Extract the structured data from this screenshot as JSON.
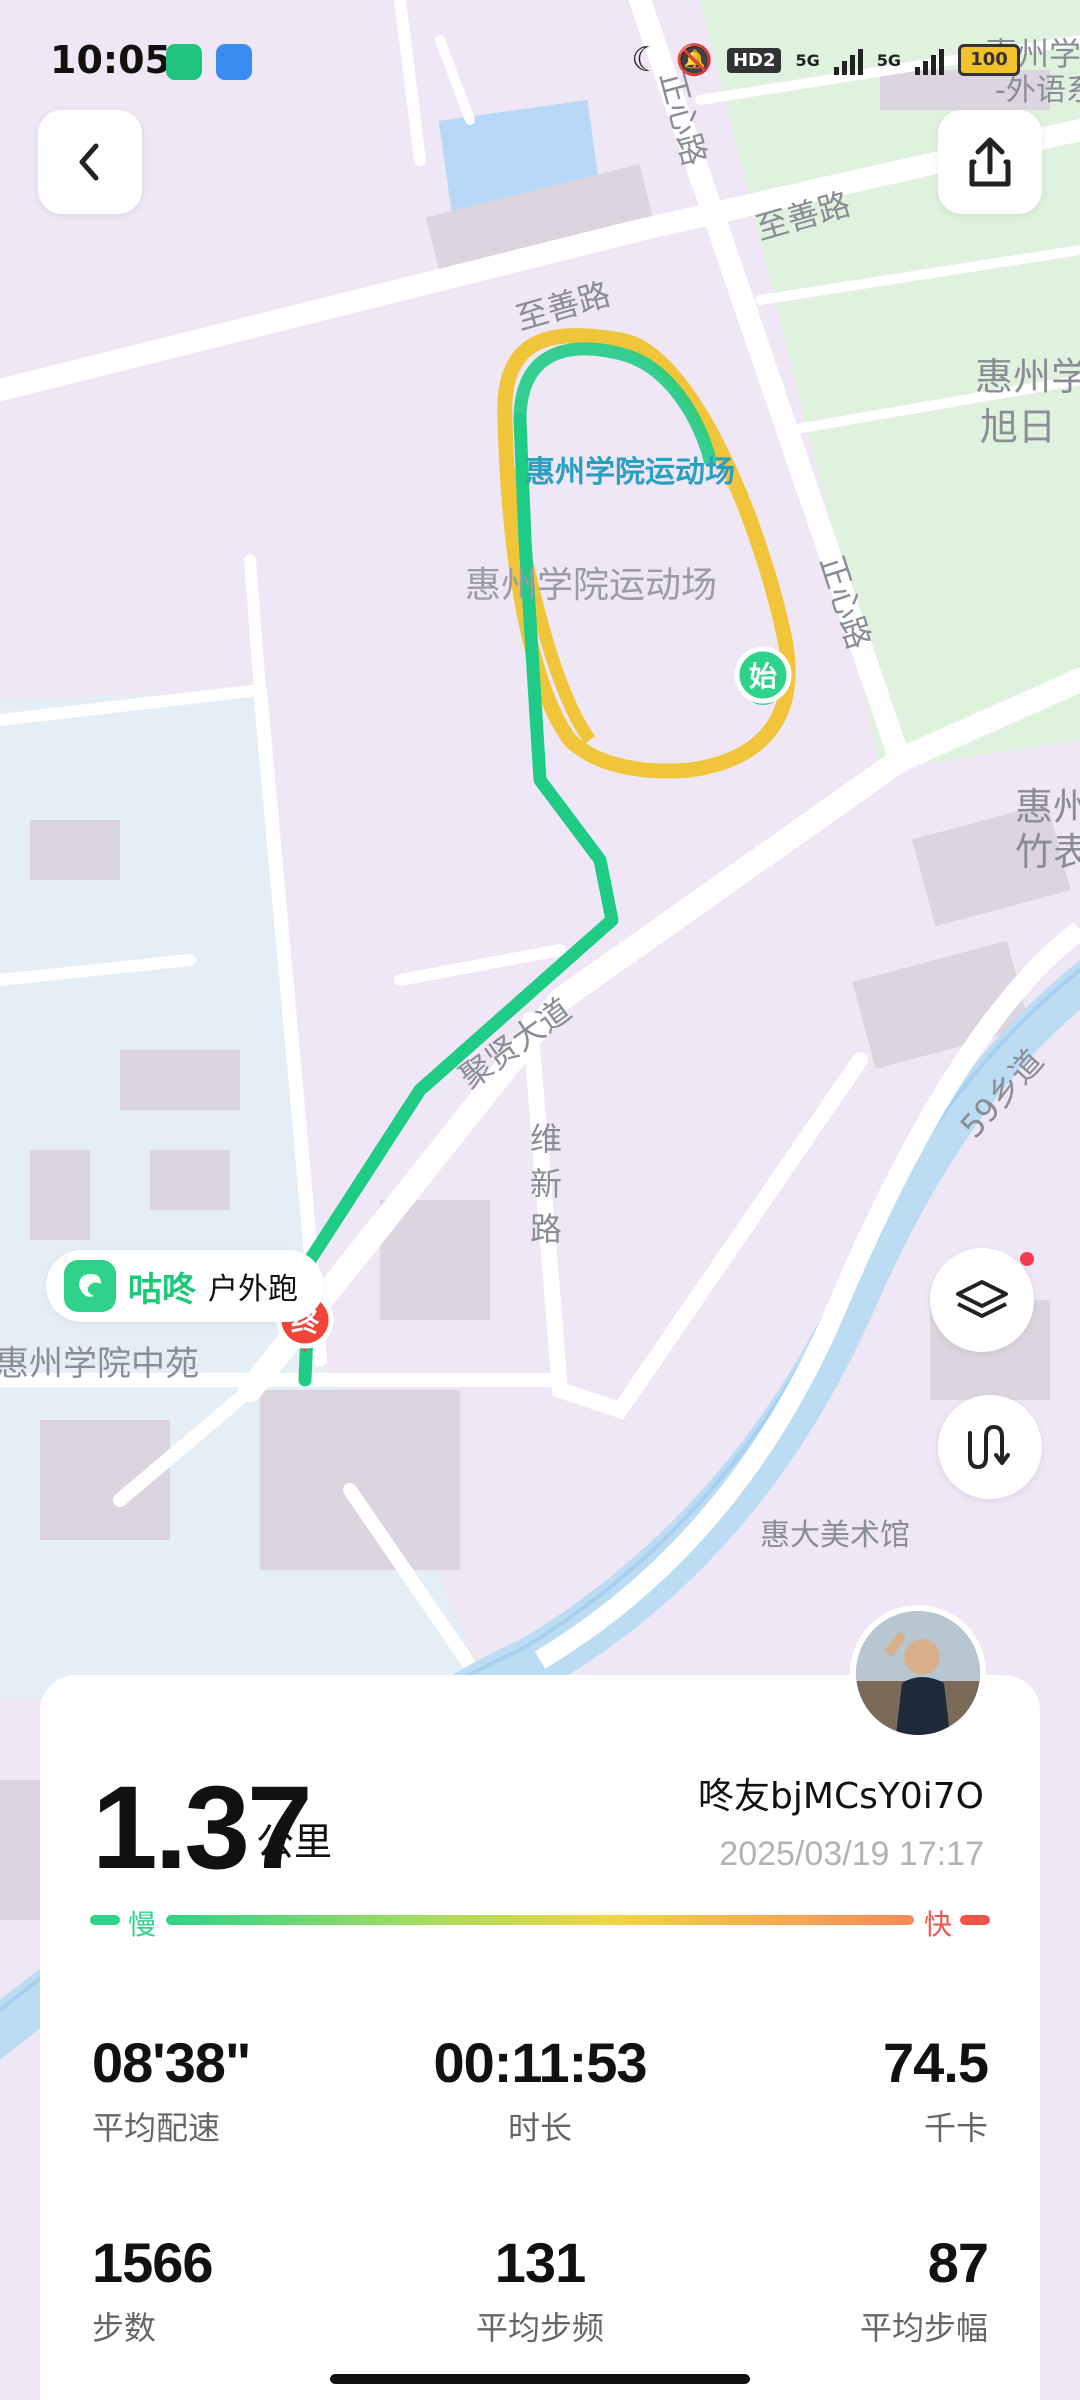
{
  "status_bar": {
    "time": "10:05",
    "network1": "5G",
    "network2": "5G",
    "hd": "HD2",
    "battery": "100"
  },
  "map": {
    "roads": {
      "zhengxin_top": "正心路",
      "zhishan_left": "至善路",
      "zhishan_right": "至善路",
      "zhengxin_right": "正心路",
      "juxian": "聚贤大道",
      "weixin": "维新路",
      "road59": "59乡道"
    },
    "pois": {
      "stadium_label": "惠州学院运动场",
      "stadium_area": "惠州学院运动场",
      "middle_court": "惠州学院中苑",
      "art_museum": "惠大美术馆",
      "poi_right_top1": "惠州学",
      "poi_right_top2": "-外语系",
      "poi_right_mid1": "惠州学",
      "poi_right_mid2": "旭日",
      "poi_right_low1": "惠州",
      "poi_right_low2": "竹表"
    },
    "markers": {
      "start": "始",
      "end": "终"
    },
    "colors": {
      "route_green": "#1fcc85",
      "route_yellow": "#f0c53a",
      "start_marker": "#2fd28a",
      "end_marker": "#f2453a"
    }
  },
  "brand": {
    "name": "咕咚",
    "activity": "户外跑"
  },
  "summary": {
    "distance": "1.37",
    "distance_unit": "公里",
    "username": "咚友bjMCsY0i7O",
    "datetime": "2025/03/19 17:17",
    "scale_slow": "慢",
    "scale_fast": "快"
  },
  "stats": [
    {
      "value": "08'38\"",
      "label": "平均配速"
    },
    {
      "value": "00:11:53",
      "label": "时长"
    },
    {
      "value": "74.5",
      "label": "千卡"
    },
    {
      "value": "1566",
      "label": "步数"
    },
    {
      "value": "131",
      "label": "平均步频"
    },
    {
      "value": "87",
      "label": "平均步幅"
    }
  ],
  "icons": {
    "back": "chevron-left-icon",
    "share": "share-icon",
    "layers": "layers-icon",
    "route": "route-icon"
  }
}
